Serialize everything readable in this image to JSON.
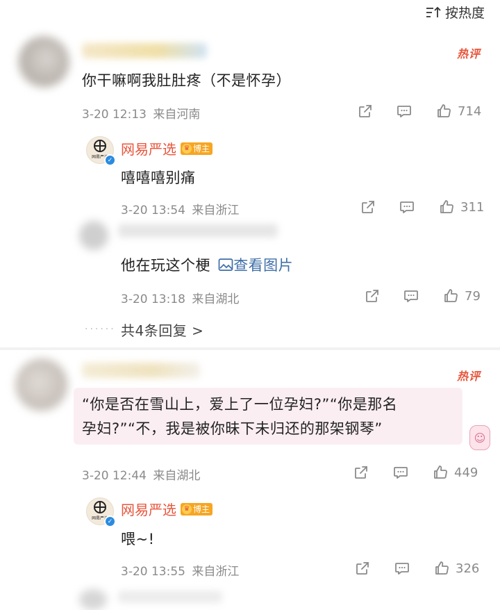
{
  "sort": {
    "label": "按热度"
  },
  "comments": [
    {
      "badge": "热评",
      "text": "你干嘛啊我肚肚疼（不是怀孕）",
      "time": "3-20 12:13",
      "location": "来自河南",
      "likes": "714",
      "reply": {
        "author": "网易严选",
        "avatar_label": "网易严选",
        "role": "博主",
        "text": "嘻嘻嘻别痛",
        "time": "3-20 13:54",
        "location": "来自浙江",
        "likes": "311"
      },
      "reply2": {
        "text": "他在玩这个梗",
        "link": "查看图片",
        "time": "3-20 13:18",
        "location": "来自湖北",
        "likes": "79"
      },
      "more_replies": "共4条回复 >"
    },
    {
      "badge": "热评",
      "text_line1": "“你是否在雪山上，爱上了一位孕妇?”“你是那名",
      "text_line2": "孕妇?”“不，我是被你昧下未归还的那架钢琴”",
      "time": "3-20 12:44",
      "location": "来自湖北",
      "likes": "449",
      "reply": {
        "author": "网易严选",
        "avatar_label": "网易严选",
        "role": "博主",
        "text": "喂~!",
        "time": "3-20 13:55",
        "location": "来自浙江",
        "likes": "326"
      }
    }
  ],
  "icons": [
    "sort-icon",
    "share-icon",
    "comment-icon",
    "like-icon",
    "image-icon",
    "verified-icon",
    "crown-icon"
  ],
  "colors": {
    "accent": "#e8553c",
    "meta": "#8a8a8a",
    "blogger_badge": "#f6a623",
    "verified": "#2b8be0",
    "quote_bg": "#fbeef2"
  }
}
